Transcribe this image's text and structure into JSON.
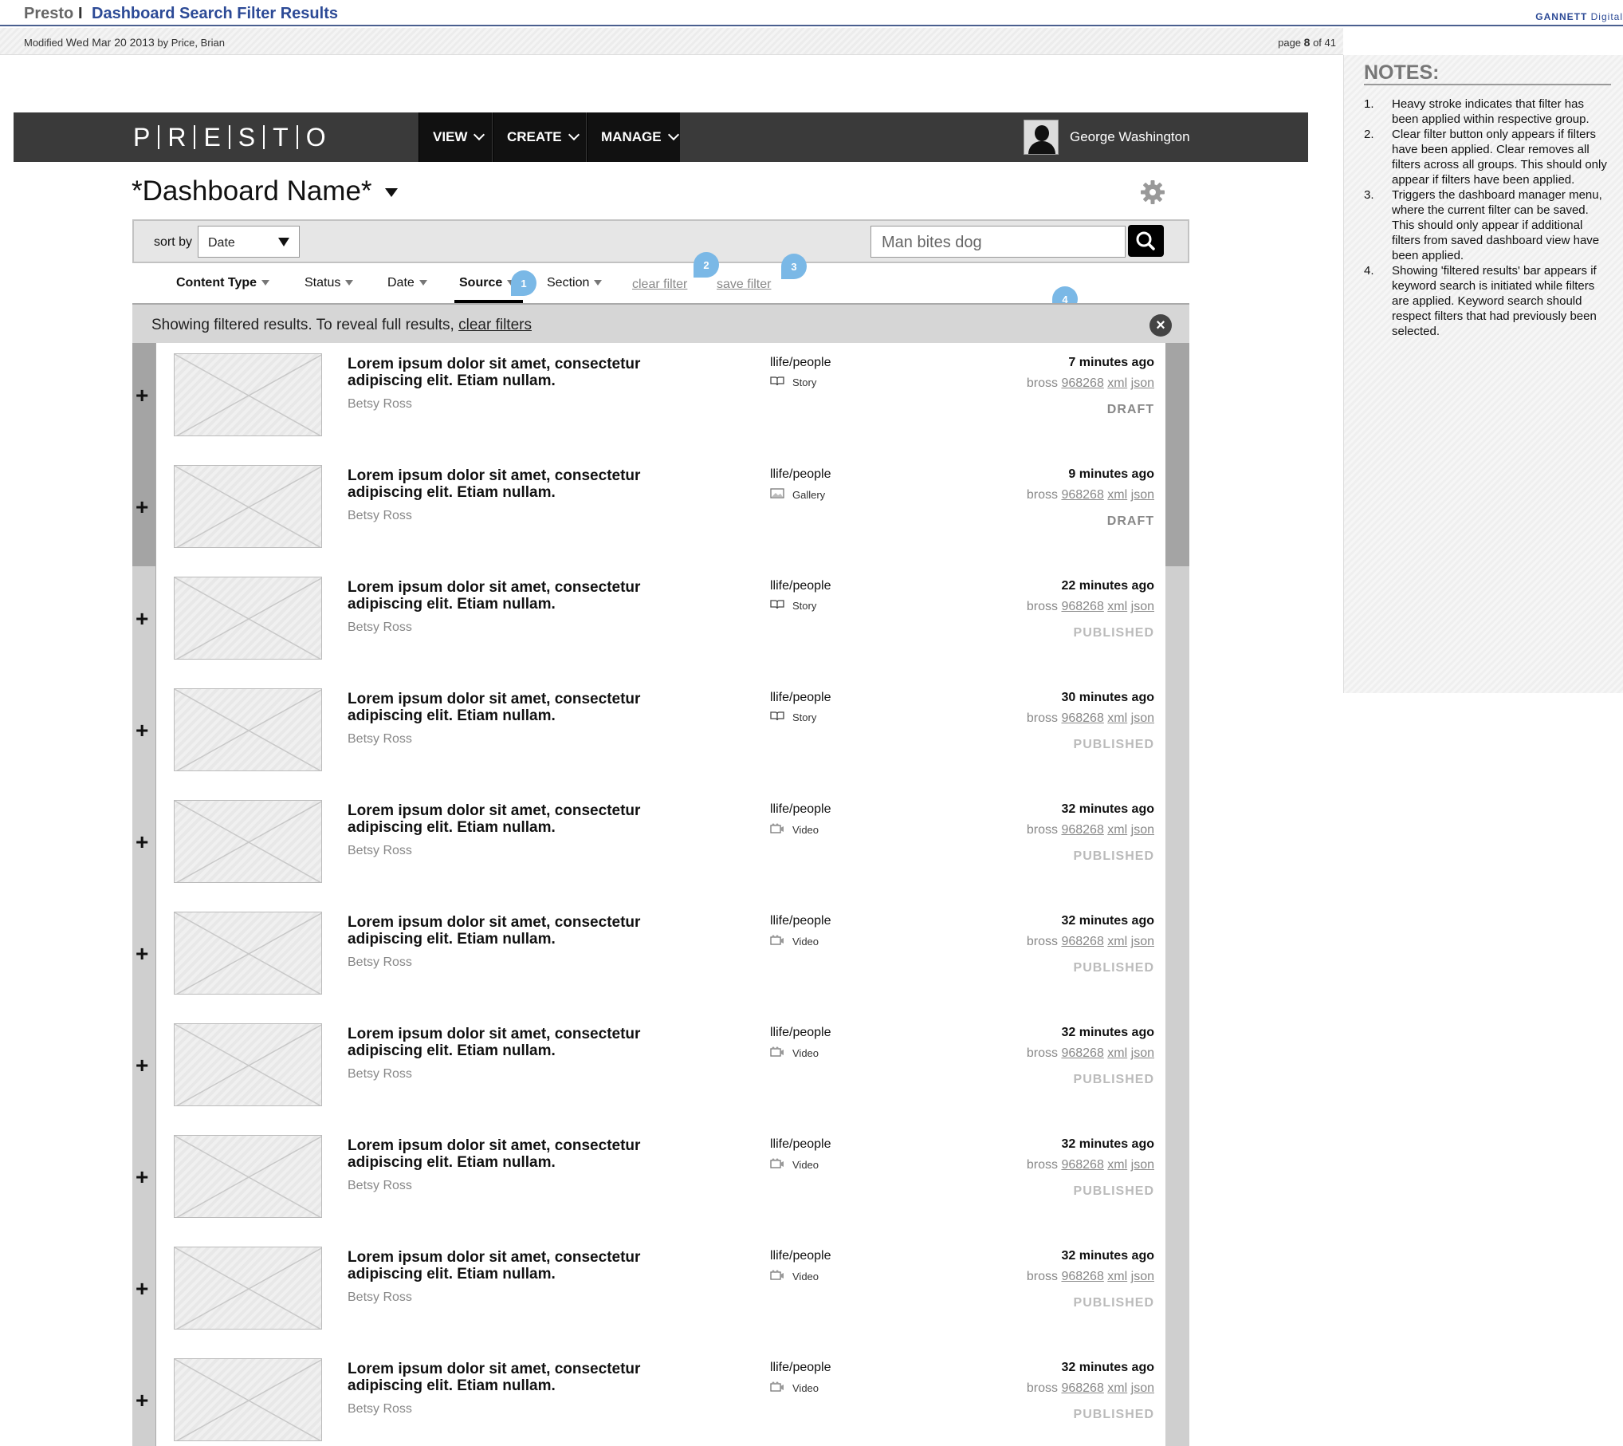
{
  "doc": {
    "project": "Presto",
    "separator": "I",
    "page_title": "Dashboard Search Filter Results",
    "brand_a": "GANNETT",
    "brand_b": "Digital",
    "modified_label": "Modified",
    "modified_date": "Wed Mar 20 2013",
    "modified_by": "by Price, Brian",
    "page_label": "page",
    "page_num": "8",
    "page_of": "of 41"
  },
  "notes": {
    "title": "NOTES:",
    "items": [
      {
        "n": "1.",
        "text": "Heavy stroke indicates that filter has been applied within respective group."
      },
      {
        "n": "2.",
        "text": "Clear filter button only appears if filters have been applied. Clear removes all filters across all groups. This should only appear if filters have been applied."
      },
      {
        "n": "3.",
        "text": "Triggers the dashboard manager menu, where the current filter can be saved. This should only appear if additional filters from saved dashboard view have been applied."
      },
      {
        "n": "4.",
        "text": "Showing 'filtered results' bar appears if keyword search is initiated while filters are applied. Keyword search should respect filters that had previously been selected."
      }
    ]
  },
  "nav": {
    "logo_letters": [
      "P",
      "R",
      "E",
      "S",
      "T",
      "O"
    ],
    "view": "VIEW",
    "create": "CREATE",
    "manage": "MANAGE",
    "user": "George Washington"
  },
  "dashboard": {
    "name": "*Dashboard Name*"
  },
  "sort": {
    "label": "sort by",
    "value": "Date",
    "search_value": "Man bites dog"
  },
  "filters": {
    "content_type": "Content Type",
    "status": "Status",
    "date": "Date",
    "source": "Source",
    "section": "Section",
    "clear": "clear filter",
    "save": "save filter",
    "callouts": [
      "1",
      "2",
      "3",
      "4"
    ]
  },
  "filtered": {
    "text": "Showing filtered results. To reveal full results, ",
    "link": "clear filters"
  },
  "rows": [
    {
      "headline": "Lorem ipsum dolor sit amet, consectetur adipiscing elit. Etiam nullam.",
      "author": "Betsy Ross",
      "section": "llife/people",
      "type": "Story",
      "icon": "book-icon",
      "time": "7 minutes ago",
      "user": "bross",
      "id": "968268",
      "xml": "xml",
      "json": "json",
      "status": "DRAFT"
    },
    {
      "headline": "Lorem ipsum dolor sit amet, consectetur adipiscing elit. Etiam nullam.",
      "author": "Betsy Ross",
      "section": "llife/people",
      "type": "Gallery",
      "icon": "image-icon",
      "time": "9 minutes ago",
      "user": "bross",
      "id": "968268",
      "xml": "xml",
      "json": "json",
      "status": "DRAFT"
    },
    {
      "headline": "Lorem ipsum dolor sit amet, consectetur adipiscing elit. Etiam nullam.",
      "author": "Betsy Ross",
      "section": "llife/people",
      "type": "Story",
      "icon": "book-icon",
      "time": "22 minutes ago",
      "user": "bross",
      "id": "968268",
      "xml": "xml",
      "json": "json",
      "status": "PUBLISHED"
    },
    {
      "headline": "Lorem ipsum dolor sit amet, consectetur adipiscing elit. Etiam nullam.",
      "author": "Betsy Ross",
      "section": "llife/people",
      "type": "Story",
      "icon": "book-icon",
      "time": "30 minutes ago",
      "user": "bross",
      "id": "968268",
      "xml": "xml",
      "json": "json",
      "status": "PUBLISHED"
    },
    {
      "headline": "Lorem ipsum dolor sit amet, consectetur adipiscing elit. Etiam nullam.",
      "author": "Betsy Ross",
      "section": "llife/people",
      "type": "Video",
      "icon": "video-icon",
      "time": "32 minutes ago",
      "user": "bross",
      "id": "968268",
      "xml": "xml",
      "json": "json",
      "status": "PUBLISHED"
    },
    {
      "headline": "Lorem ipsum dolor sit amet, consectetur adipiscing elit. Etiam nullam.",
      "author": "Betsy Ross",
      "section": "llife/people",
      "type": "Video",
      "icon": "video-icon",
      "time": "32 minutes ago",
      "user": "bross",
      "id": "968268",
      "xml": "xml",
      "json": "json",
      "status": "PUBLISHED"
    },
    {
      "headline": "Lorem ipsum dolor sit amet, consectetur adipiscing elit. Etiam nullam.",
      "author": "Betsy Ross",
      "section": "llife/people",
      "type": "Video",
      "icon": "video-icon",
      "time": "32 minutes ago",
      "user": "bross",
      "id": "968268",
      "xml": "xml",
      "json": "json",
      "status": "PUBLISHED"
    },
    {
      "headline": "Lorem ipsum dolor sit amet, consectetur adipiscing elit. Etiam nullam.",
      "author": "Betsy Ross",
      "section": "llife/people",
      "type": "Video",
      "icon": "video-icon",
      "time": "32 minutes ago",
      "user": "bross",
      "id": "968268",
      "xml": "xml",
      "json": "json",
      "status": "PUBLISHED"
    },
    {
      "headline": "Lorem ipsum dolor sit amet, consectetur adipiscing elit. Etiam nullam.",
      "author": "Betsy Ross",
      "section": "llife/people",
      "type": "Video",
      "icon": "video-icon",
      "time": "32 minutes ago",
      "user": "bross",
      "id": "968268",
      "xml": "xml",
      "json": "json",
      "status": "PUBLISHED"
    },
    {
      "headline": "Lorem ipsum dolor sit amet, consectetur adipiscing elit. Etiam nullam.",
      "author": "Betsy Ross",
      "section": "llife/people",
      "type": "Video",
      "icon": "video-icon",
      "time": "32 minutes ago",
      "user": "bross",
      "id": "968268",
      "xml": "xml",
      "json": "json",
      "status": "PUBLISHED"
    }
  ]
}
